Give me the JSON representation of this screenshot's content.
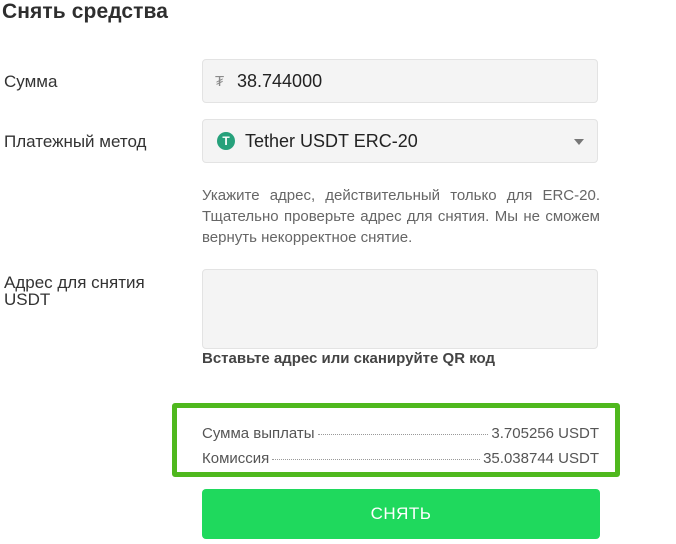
{
  "page": {
    "title": "Снять средства"
  },
  "form": {
    "amount": {
      "label": "Сумма",
      "currency_symbol": "₮",
      "value": "38.744000"
    },
    "method": {
      "label": "Платежный метод",
      "icon": "tether-icon",
      "icon_glyph": "T",
      "value": "Tether USDT ERC-20"
    },
    "hint": "Укажите адрес, действительный только для ERC-20. Тщательно проверьте адрес для снятия. Мы не сможем вернуть некорректное снятие.",
    "address": {
      "label": "Адрес для снятия USDT",
      "value": "",
      "helper": "Вставьте адрес или сканируйте QR код"
    }
  },
  "summary": {
    "payout": {
      "label": "Сумма выплаты",
      "value": "3.705256 USDT"
    },
    "fee": {
      "label": "Комиссия",
      "value": "35.038744 USDT"
    }
  },
  "actions": {
    "withdraw_label": "СНЯТЬ"
  },
  "colors": {
    "button": "#1fd95d",
    "highlight_border": "#4fb81e",
    "tether": "#26a17b"
  }
}
